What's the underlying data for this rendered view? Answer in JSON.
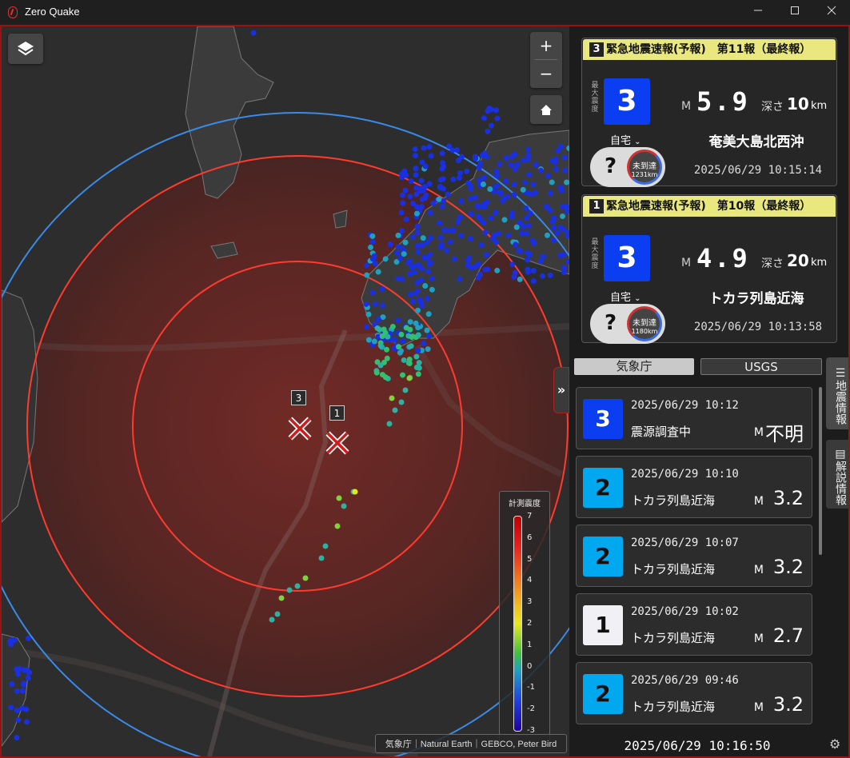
{
  "app": {
    "title": "Zero Quake"
  },
  "window": {
    "minimize_icon": "minimize-icon",
    "maximize_icon": "maximize-icon",
    "close_icon": "close-icon"
  },
  "map": {
    "zoom_in": "+",
    "zoom_out": "−",
    "layers_icon": "layers-icon",
    "home_icon": "home-icon",
    "collapse_label": "»",
    "markers": [
      {
        "label": "3"
      },
      {
        "label": "1"
      }
    ],
    "legend": {
      "title": "計測震度",
      "ticks": [
        "7",
        "6",
        "5",
        "4",
        "3",
        "2",
        "1",
        "0",
        "-1",
        "-2",
        "-3"
      ]
    },
    "attribution": "気象庁｜Natural Earth｜GEBCO, Peter Bird"
  },
  "colors": {
    "accent_red": "#9a1111",
    "eew_header": "#e8e87e",
    "int1": "#f0f0f5",
    "int2": "#00a8f0",
    "int3": "#0a3ef0"
  },
  "eew": [
    {
      "number": "3",
      "title": "緊急地震速報(予報)　第11報（最終報）",
      "max_label": "最大震度",
      "intensity": "3",
      "mag_prefix": "M",
      "magnitude": "5.9",
      "depth_label": "深さ",
      "depth": "10",
      "depth_unit": "km",
      "home": "自宅",
      "home_intensity": "?",
      "arrival_status": "未到達",
      "distance": "1231km",
      "region": "奄美大島北西沖",
      "time": "2025/06/29 10:15:14"
    },
    {
      "number": "1",
      "title": "緊急地震速報(予報)　第10報（最終報）",
      "max_label": "最大震度",
      "intensity": "3",
      "mag_prefix": "M",
      "magnitude": "4.9",
      "depth_label": "深さ",
      "depth": "20",
      "depth_unit": "km",
      "home": "自宅",
      "home_intensity": "?",
      "arrival_status": "未到達",
      "distance": "1180km",
      "region": "トカラ列島近海",
      "time": "2025/06/29 10:13:58"
    }
  ],
  "tabs": {
    "jma": "気象庁",
    "usgs": "USGS"
  },
  "side_tabs": {
    "quake_info": "地震情報",
    "commentary": "解説情報"
  },
  "quakes": [
    {
      "intensity": "3",
      "time": "2025/06/29 10:12",
      "region": "震源調査中",
      "mag_prefix": "M",
      "magnitude": "不明"
    },
    {
      "intensity": "2",
      "time": "2025/06/29 10:10",
      "region": "トカラ列島近海",
      "mag_prefix": "M",
      "magnitude": "3.2"
    },
    {
      "intensity": "2",
      "time": "2025/06/29 10:07",
      "region": "トカラ列島近海",
      "mag_prefix": "M",
      "magnitude": "3.2"
    },
    {
      "intensity": "1",
      "time": "2025/06/29 10:02",
      "region": "トカラ列島近海",
      "mag_prefix": "M",
      "magnitude": "2.7"
    },
    {
      "intensity": "2",
      "time": "2025/06/29 09:46",
      "region": "トカラ列島近海",
      "mag_prefix": "M",
      "magnitude": "3.2"
    }
  ],
  "clock": "2025/06/29 10:16:50",
  "settings_icon": "gear-icon"
}
